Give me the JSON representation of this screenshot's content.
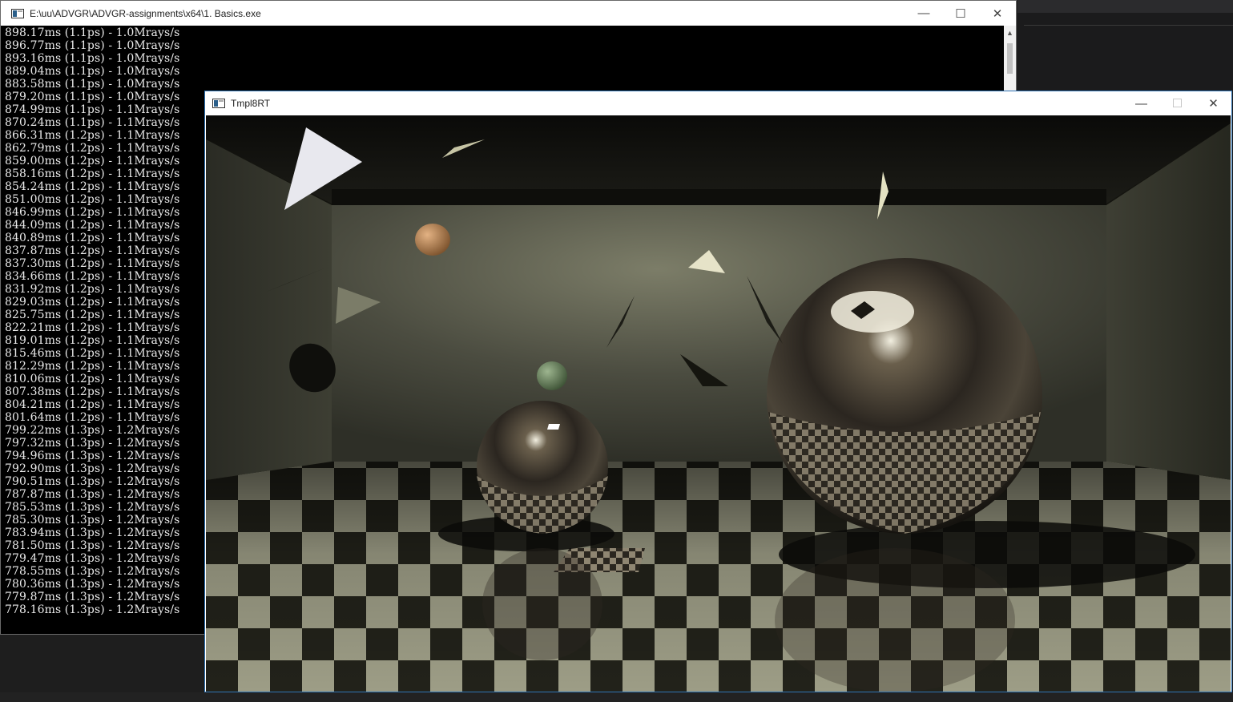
{
  "console_window": {
    "title": "E:\\uu\\ADVGR\\ADVGR-assignments\\x64\\1. Basics.exe",
    "lines": [
      "898.17ms (1.1ps) - 1.0Mrays/s",
      "896.77ms (1.1ps) - 1.0Mrays/s",
      "893.16ms (1.1ps) - 1.0Mrays/s",
      "889.04ms (1.1ps) - 1.0Mrays/s",
      "883.58ms (1.1ps) - 1.0Mrays/s",
      "879.20ms (1.1ps) - 1.0Mrays/s",
      "874.99ms (1.1ps) - 1.1Mrays/s",
      "870.24ms (1.1ps) - 1.1Mrays/s",
      "866.31ms (1.2ps) - 1.1Mrays/s",
      "862.79ms (1.2ps) - 1.1Mrays/s",
      "859.00ms (1.2ps) - 1.1Mrays/s",
      "858.16ms (1.2ps) - 1.1Mrays/s",
      "854.24ms (1.2ps) - 1.1Mrays/s",
      "851.00ms (1.2ps) - 1.1Mrays/s",
      "846.99ms (1.2ps) - 1.1Mrays/s",
      "844.09ms (1.2ps) - 1.1Mrays/s",
      "840.89ms (1.2ps) - 1.1Mrays/s",
      "837.87ms (1.2ps) - 1.1Mrays/s",
      "837.30ms (1.2ps) - 1.1Mrays/s",
      "834.66ms (1.2ps) - 1.1Mrays/s",
      "831.92ms (1.2ps) - 1.1Mrays/s",
      "829.03ms (1.2ps) - 1.1Mrays/s",
      "825.75ms (1.2ps) - 1.1Mrays/s",
      "822.21ms (1.2ps) - 1.1Mrays/s",
      "819.01ms (1.2ps) - 1.1Mrays/s",
      "815.46ms (1.2ps) - 1.1Mrays/s",
      "812.29ms (1.2ps) - 1.1Mrays/s",
      "810.06ms (1.2ps) - 1.1Mrays/s",
      "807.38ms (1.2ps) - 1.1Mrays/s",
      "804.21ms (1.2ps) - 1.1Mrays/s",
      "801.64ms (1.2ps) - 1.1Mrays/s",
      "799.22ms (1.3ps) - 1.2Mrays/s",
      "797.32ms (1.3ps) - 1.2Mrays/s",
      "794.96ms (1.3ps) - 1.2Mrays/s",
      "792.90ms (1.3ps) - 1.2Mrays/s",
      "790.51ms (1.3ps) - 1.2Mrays/s",
      "787.87ms (1.3ps) - 1.2Mrays/s",
      "785.53ms (1.3ps) - 1.2Mrays/s",
      "785.30ms (1.3ps) - 1.2Mrays/s",
      "783.94ms (1.3ps) - 1.2Mrays/s",
      "781.50ms (1.3ps) - 1.2Mrays/s",
      "779.47ms (1.3ps) - 1.2Mrays/s",
      "778.55ms (1.3ps) - 1.2Mrays/s",
      "780.36ms (1.3ps) - 1.2Mrays/s",
      "779.87ms (1.3ps) - 1.2Mrays/s",
      "778.16ms (1.3ps) - 1.2Mrays/s"
    ],
    "buttons": {
      "minimize": "—",
      "maximize": "☐",
      "close": "✕"
    },
    "scroll_up_glyph": "▲"
  },
  "render_window": {
    "title": "Tmpl8RT",
    "buttons": {
      "minimize": "—",
      "maximize": "☐",
      "close": "✕"
    }
  },
  "colors": {
    "console_bg": "#000000",
    "console_text": "#ebebeb",
    "floor_light": "#9d9d86",
    "floor_dark": "#22221a",
    "wall": "#4b4c40",
    "sphere_orange": "#c48a52",
    "sphere_green": "#6f8a64",
    "accent": "#0078d7"
  }
}
